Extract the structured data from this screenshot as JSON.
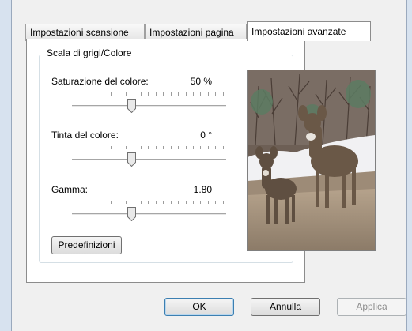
{
  "tabs": [
    {
      "label": "Impostazioni scansione"
    },
    {
      "label": "Impostazioni pagina"
    },
    {
      "label": "Impostazioni avanzate"
    }
  ],
  "group": {
    "title": "Scala di grigi/Colore"
  },
  "sliders": [
    {
      "label": "Saturazione del colore:",
      "value": "50 %"
    },
    {
      "label": "Tinta del colore:",
      "value": "0 °"
    },
    {
      "label": "Gamma:",
      "value": "1.80"
    }
  ],
  "presets_button": "Predefinizioni",
  "buttons": {
    "ok": "OK",
    "cancel": "Annulla",
    "apply": "Applica"
  }
}
